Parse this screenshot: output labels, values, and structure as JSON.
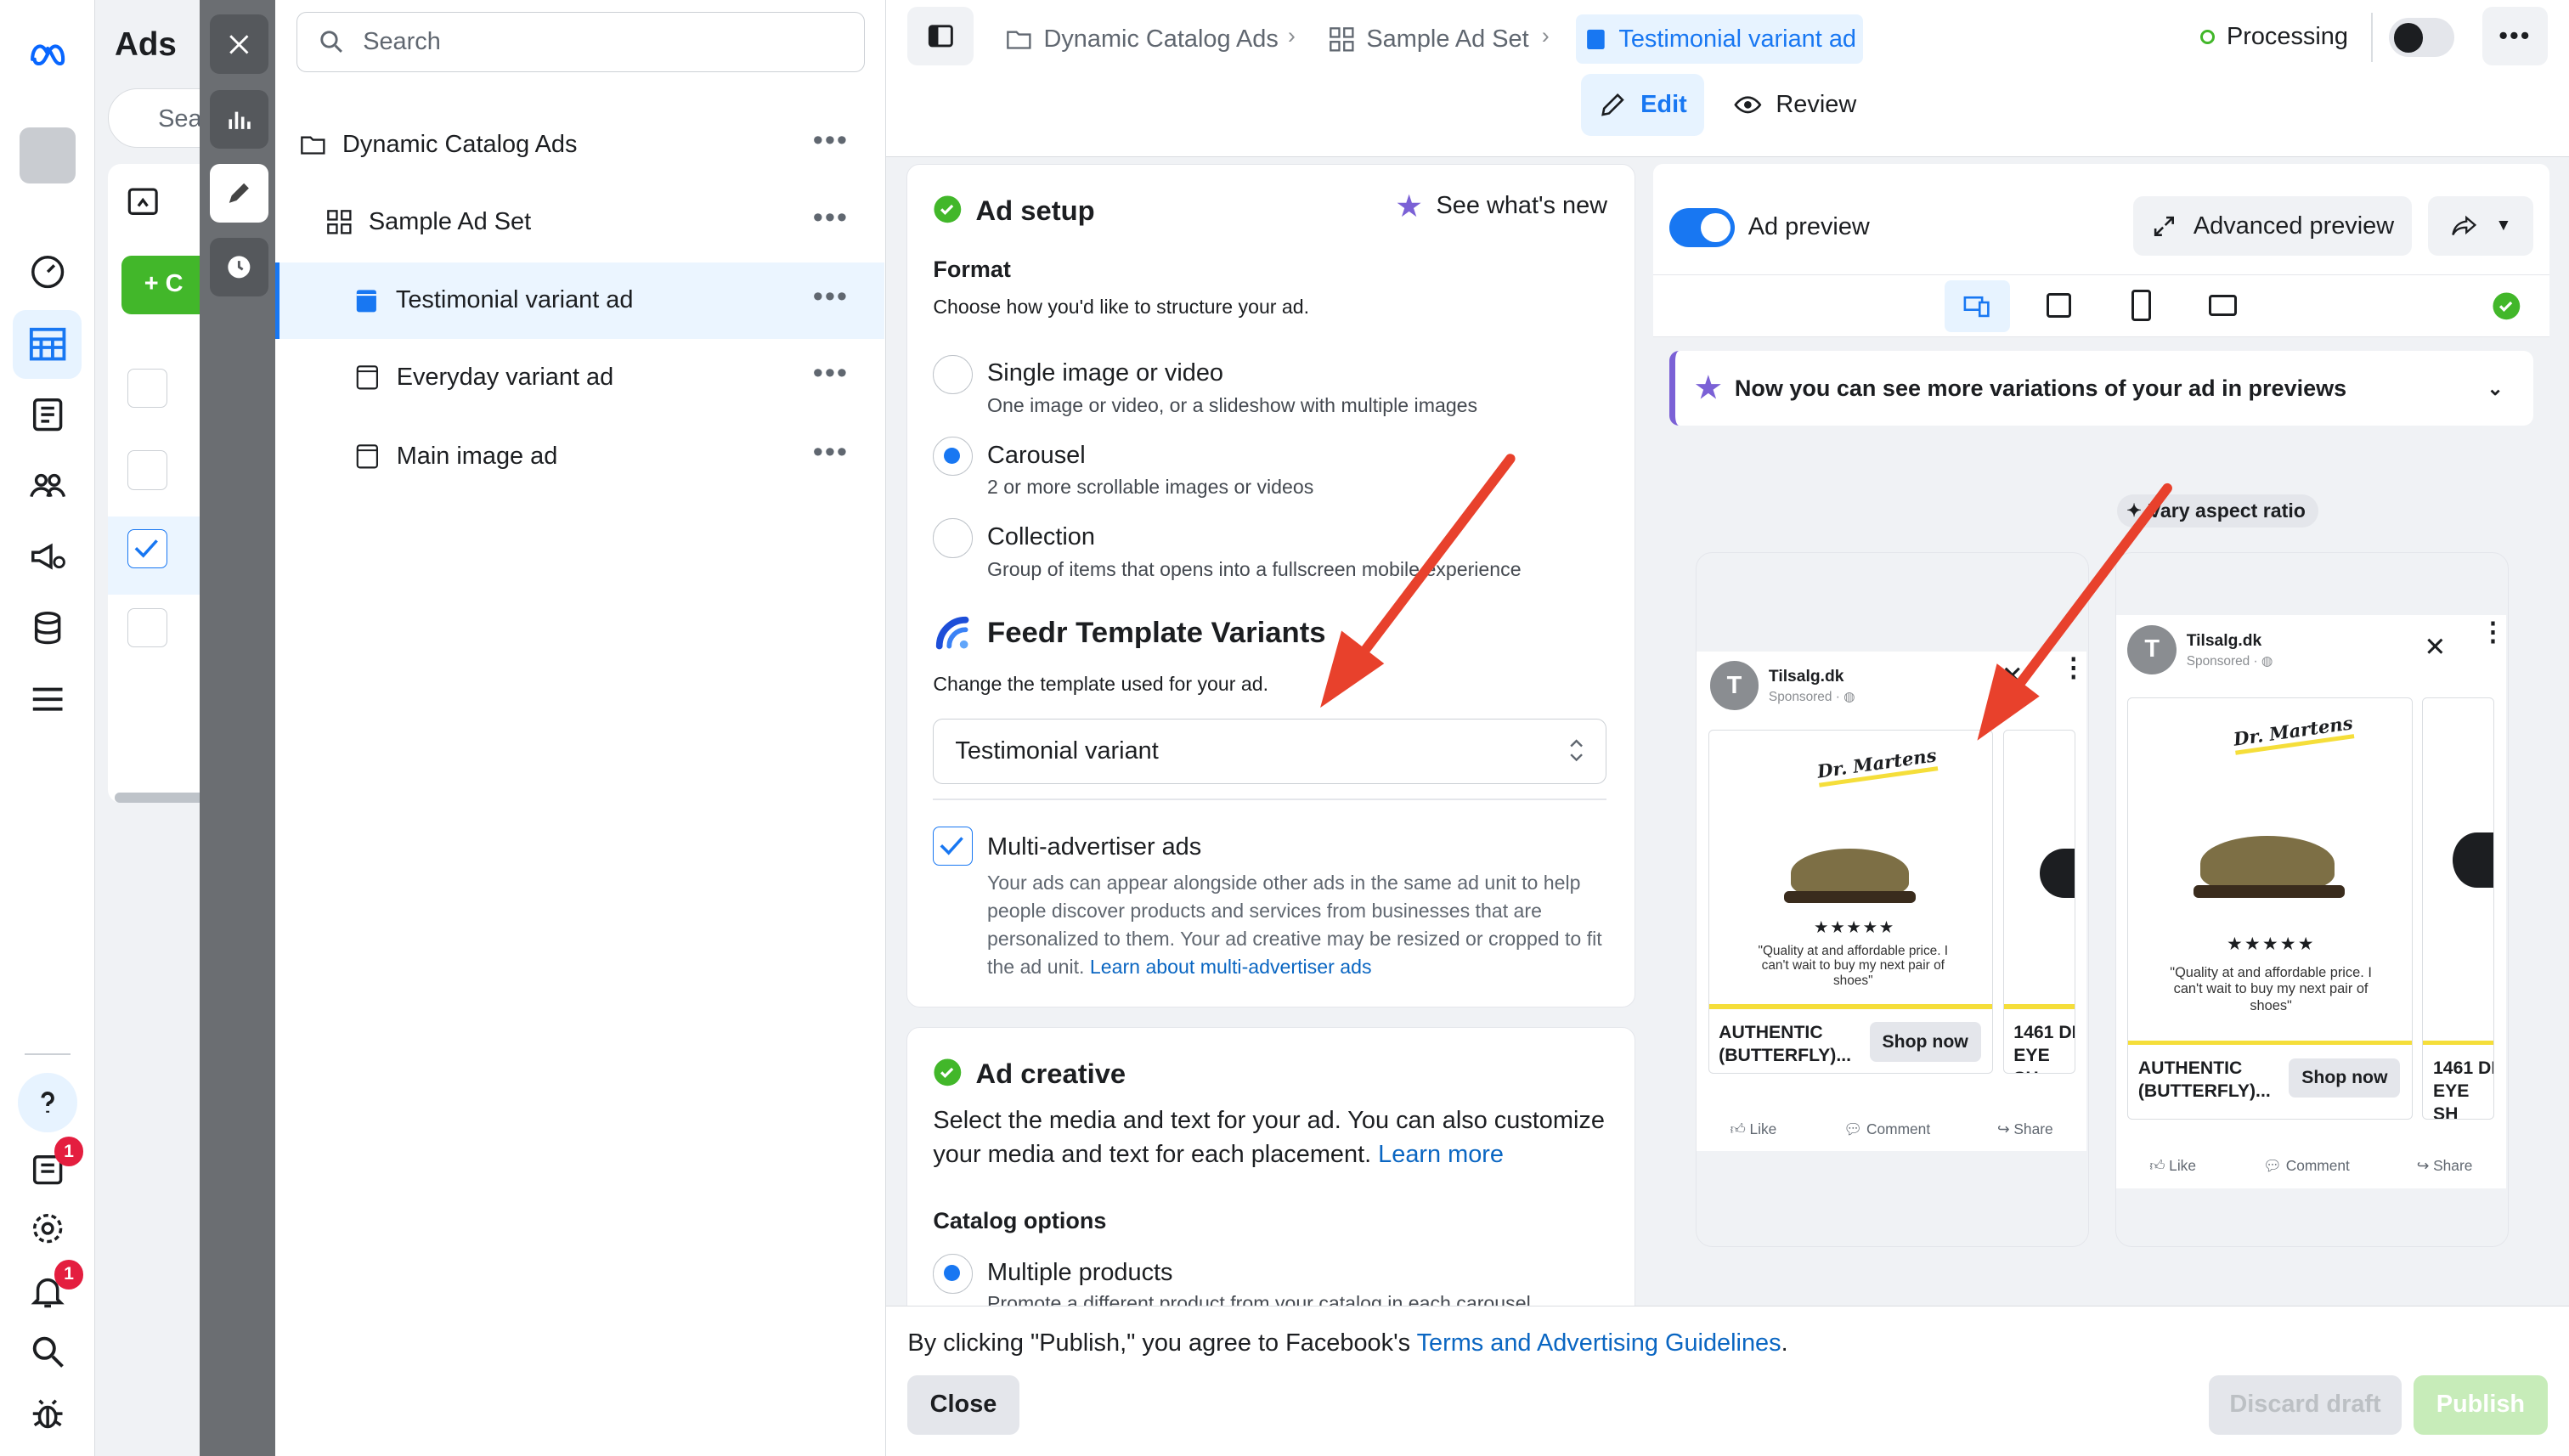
{
  "nav": {
    "badge_help": "1",
    "badge_notif": "1"
  },
  "under": {
    "title": "Ads",
    "search_placeholder": "Sea",
    "create_label": "C"
  },
  "tree": {
    "search_placeholder": "Search",
    "items": [
      {
        "label": "Dynamic Catalog Ads"
      },
      {
        "label": "Sample Ad Set"
      },
      {
        "label": "Testimonial variant ad"
      },
      {
        "label": "Everyday variant ad"
      },
      {
        "label": "Main image ad"
      }
    ]
  },
  "header": {
    "breadcrumbs": [
      "Dynamic Catalog Ads",
      "Sample Ad Set",
      "Testimonial variant ad"
    ],
    "status": "Processing",
    "tab_edit": "Edit",
    "tab_review": "Review"
  },
  "setup": {
    "title": "Ad setup",
    "whats_new": "See what's new",
    "format_label": "Format",
    "format_desc": "Choose how you'd like to structure your ad.",
    "options": [
      {
        "title": "Single image or video",
        "desc": "One image or video, or a slideshow with multiple images"
      },
      {
        "title": "Carousel",
        "desc": "2 or more scrollable images or videos"
      },
      {
        "title": "Collection",
        "desc": "Group of items that opens into a fullscreen mobile experience"
      }
    ],
    "feedr_title": "Feedr Template Variants",
    "feedr_desc": "Change the template used for your ad.",
    "template_value": "Testimonial variant",
    "multi_label": "Multi-advertiser ads",
    "multi_desc": "Your ads can appear alongside other ads in the same ad unit to help people discover products and services from businesses that are personalized to them. Your ad creative may be resized or cropped to fit the ad unit.",
    "multi_link": "Learn about multi-advertiser ads"
  },
  "creative": {
    "title": "Ad creative",
    "desc": "Select the media and text for your ad. You can also customize your media and text for each placement.",
    "learn_more": "Learn more",
    "catalog_label": "Catalog options",
    "multi_products": "Multiple products",
    "multi_products_desc": "Promote a different product from your catalog in each carousel"
  },
  "preview": {
    "toggle_label": "Ad preview",
    "advanced": "Advanced preview",
    "banner": "Now you can see more variations of your ad in previews",
    "vary": "Vary aspect ratio",
    "page_name": "Tilsalg.dk",
    "sponsored": "Sponsored · ◍",
    "avatar_letter": "T",
    "brand": "Dr. Martens",
    "stars": "★★★★★",
    "quote": "\"Quality at and affordable price. I can't wait to buy my next pair of shoes\"",
    "product_1": "AUTHENTIC (BUTTERFLY)...",
    "product_2": "1461 DI EYE SH",
    "shop_now": "Shop now",
    "like": "Like",
    "comment": "Comment",
    "share": "Share"
  },
  "footer": {
    "notice_pre": "By clicking \"Publish,\" you agree to Facebook's ",
    "notice_link": "Terms and Advertising Guidelines",
    "notice_post": ".",
    "close": "Close",
    "discard": "Discard draft",
    "publish": "Publish"
  },
  "colors": {
    "accent": "#1877f2",
    "success": "#42b72a",
    "arrow": "#e8412c"
  }
}
